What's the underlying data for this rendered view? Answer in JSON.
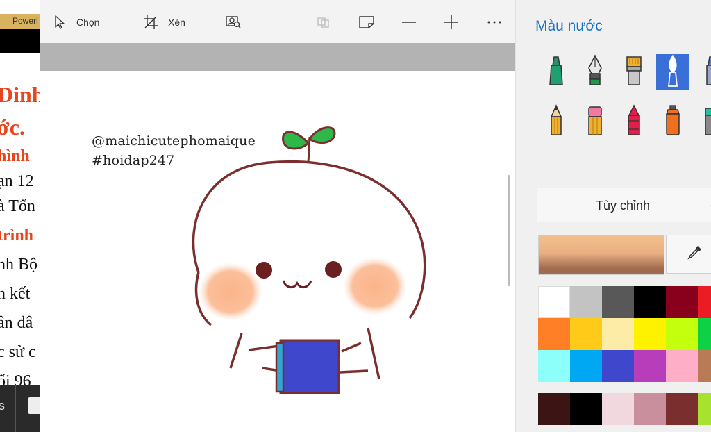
{
  "background_document": {
    "ribbon_label": "Powerl",
    "text_lines": [
      {
        "text": "Dinh",
        "color": "#e8451c",
        "bold": true,
        "size": 32
      },
      {
        "text": "ớc.",
        "color": "#e8451c",
        "bold": true,
        "size": 32
      },
      {
        "text": "hình",
        "color": "#e8451c",
        "bold": true,
        "size": 24
      },
      {
        "text": "ạn 12",
        "color": "#111111",
        "bold": false,
        "size": 24
      },
      {
        "text": "à Tốn",
        "color": "#111111",
        "bold": false,
        "size": 24
      },
      {
        "text": "trình",
        "color": "#e8451c",
        "bold": true,
        "size": 24
      },
      {
        "text": "nh Bộ",
        "color": "#111111",
        "bold": false,
        "size": 24
      },
      {
        "text": "n kết",
        "color": "#111111",
        "bold": false,
        "size": 24
      },
      {
        "text": "ân dâ",
        "color": "#111111",
        "bold": false,
        "size": 24
      },
      {
        "text": "c sử c",
        "color": "#111111",
        "bold": false,
        "size": 24
      },
      {
        "text": "ối 96",
        "color": "#111111",
        "bold": false,
        "size": 24
      }
    ]
  },
  "toolbar": {
    "select_label": "Chọn",
    "crop_label": "Xén"
  },
  "canvas": {
    "watermark_line1": "@maichicutephomaique",
    "watermark_line2": "#hoidap247"
  },
  "panel": {
    "title": "Màu nước",
    "dropdown_value": "Tùy chỉnh",
    "selected_brush": "watercolor",
    "brushes_row1": [
      "marker-icon",
      "calligraphy-pen-icon",
      "oil-brush-icon",
      "watercolor-brush-icon",
      "pixel-pen-icon"
    ],
    "brushes_row2": [
      "pencil-icon",
      "eraser-icon",
      "crayon-icon",
      "spray-can-icon",
      "fill-bucket-icon"
    ],
    "palette": [
      [
        "#ffffff",
        "#c3c3c3",
        "#585858",
        "#000000",
        "#88001b",
        "#ec1c24"
      ],
      [
        "#ff7f27",
        "#ffca18",
        "#fdeca6",
        "#fff200",
        "#c4ff0e",
        "#0ed145"
      ],
      [
        "#8cfffb",
        "#00a8f3",
        "#3f48cc",
        "#b83dba",
        "#ffaec8",
        "#b97a56"
      ],
      [
        "#3d1414",
        "#000000",
        "#f0d8de",
        "#c98f9c",
        "#7a2e2e",
        "#a6e22e"
      ]
    ]
  }
}
